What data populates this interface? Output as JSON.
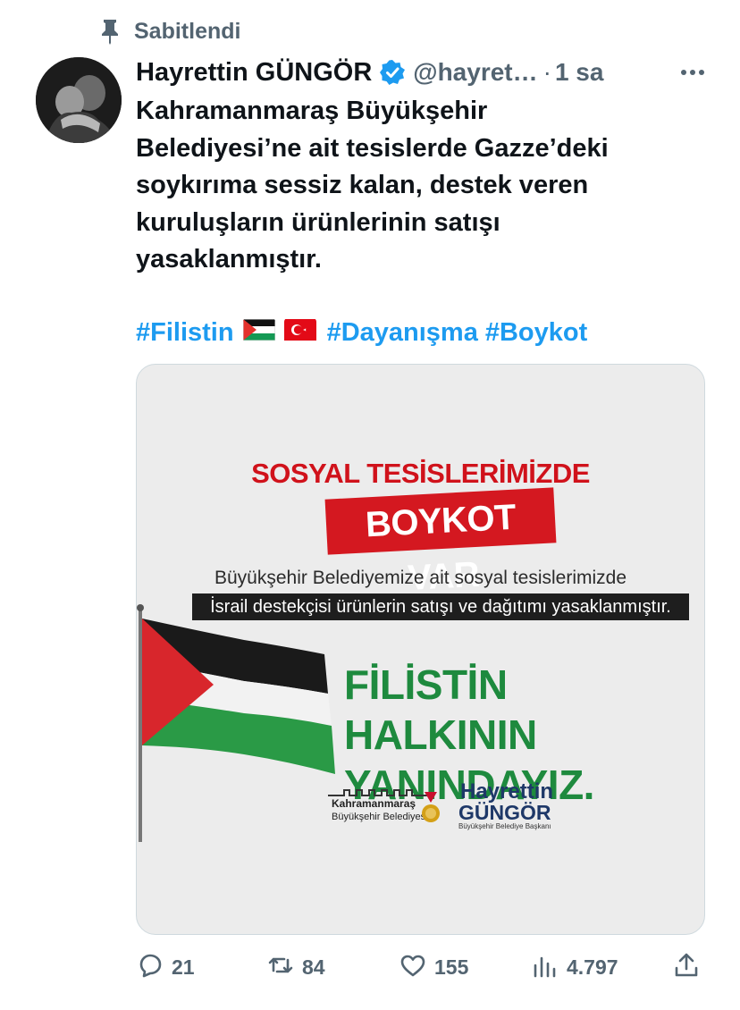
{
  "pinned": {
    "label": "Sabitlendi"
  },
  "author": {
    "display_name": "Hayrettin GÜNGÖR",
    "handle": "@hayret…",
    "separator": "·",
    "time": "1 sa"
  },
  "tweet": {
    "lines": [
      "Kahramanmaraş Büyükşehir",
      "Belediyesi’ne ait tesislerde Gazze’deki",
      "soykırıma sessiz kalan, destek veren",
      "kuruluşların ürünlerinin satışı",
      "yasaklanmıştır."
    ],
    "hashtags": [
      "#Filistin",
      "#Dayanışma",
      "#Boykot"
    ]
  },
  "media": {
    "title": "SOSYAL TESİSLERİMİZDE",
    "boykot": "BOYKOT VAR",
    "line1": "Büyükşehir Belediyemize ait sosyal tesislerimizde",
    "line2": "İsrail destekçisi ürünlerin satışı ve dağıtımı yasaklanmıştır.",
    "slogan_line1": "FİLİSTİN HALKININ",
    "slogan_line2": "YANINDAYIZ.",
    "logo_line1": "Kahramanmaraş",
    "logo_line2": "Büyükşehir Belediyesi",
    "signature_line1": "Hayrettin",
    "signature_line2": "GÜNGÖR",
    "signature_title": "Büyükşehir Belediye Başkanı"
  },
  "actions": {
    "replies": "21",
    "reposts": "84",
    "likes": "155",
    "views": "4.797"
  },
  "colors": {
    "link": "#1d9bf0",
    "secondary_text": "#536471",
    "boykot_red": "#d41820",
    "slogan_green": "#1e8a3e"
  }
}
